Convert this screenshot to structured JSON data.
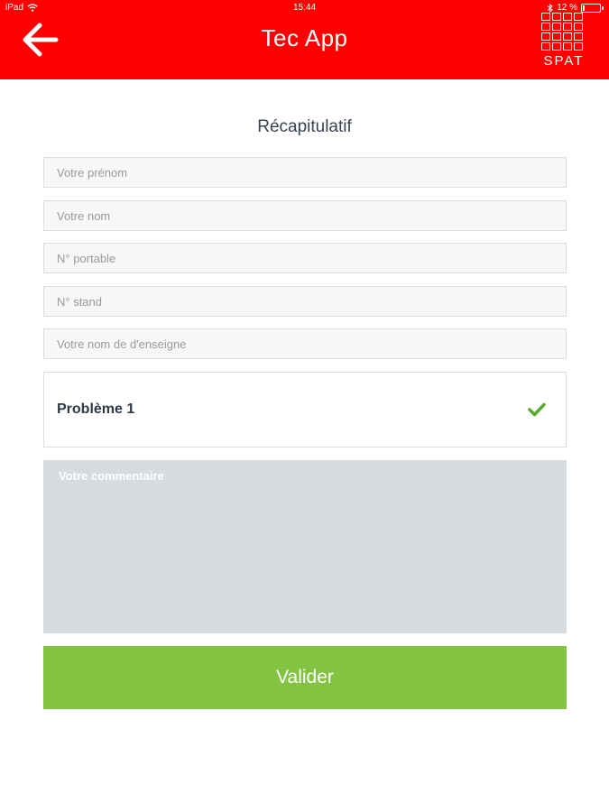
{
  "status_bar": {
    "device": "iPad",
    "time": "15:44",
    "battery": "12 %",
    "battery_level": 0.12
  },
  "header": {
    "title": "Tec App",
    "logo_text": "SPAT",
    "background_color": "#ff0000"
  },
  "page": {
    "title": "Récapitulatif"
  },
  "form": {
    "first_name_placeholder": "Votre prénom",
    "last_name_placeholder": "Votre nom",
    "phone_placeholder": "N° portable",
    "stand_placeholder": "N° stand",
    "brand_placeholder": "Votre nom de d'enseigne",
    "problem_label": "Problème 1",
    "comment_placeholder": "Votre commentaire",
    "submit_label": "Valider"
  },
  "colors": {
    "accent_red": "#ff0000",
    "submit_green": "#82c341",
    "check_green": "#5aab2e"
  }
}
